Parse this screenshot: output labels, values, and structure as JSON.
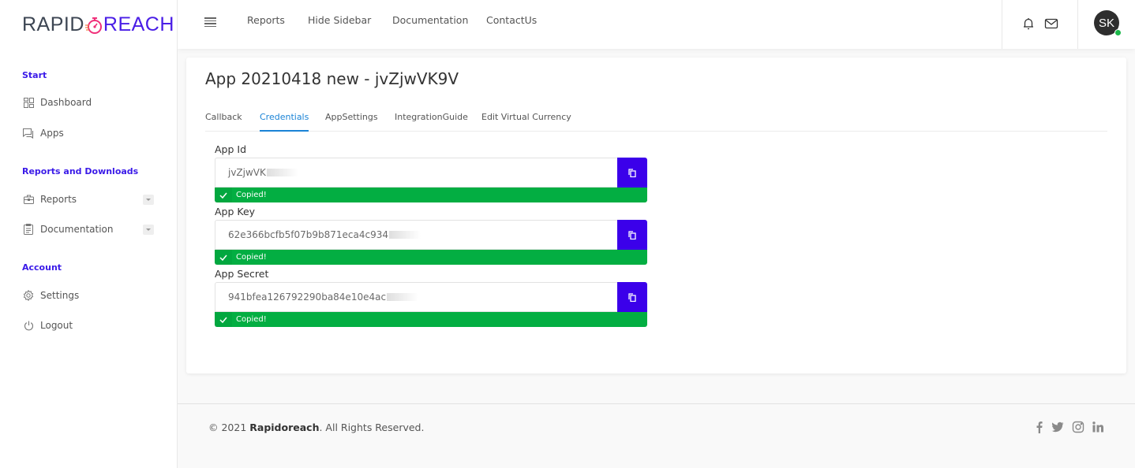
{
  "brand": {
    "part1": "RAPID",
    "part2": "REACH",
    "accent": "#4a1ee6",
    "timer_color": "#f0307a"
  },
  "topnav": {
    "links": [
      "Reports",
      "Hide Sidebar",
      "Documentation",
      "ContactUs"
    ],
    "avatar_initials": "SK",
    "status_color": "#1bb84a"
  },
  "sidebar": {
    "sections": [
      {
        "title": "Start",
        "items": [
          {
            "label": "Dashboard",
            "icon": "dashboard-icon"
          },
          {
            "label": "Apps",
            "icon": "apps-icon"
          }
        ]
      },
      {
        "title": "Reports and Downloads",
        "items": [
          {
            "label": "Reports",
            "icon": "briefcase-icon",
            "expandable": true
          },
          {
            "label": "Documentation",
            "icon": "clipboard-icon",
            "expandable": true
          }
        ]
      },
      {
        "title": "Account",
        "items": [
          {
            "label": "Settings",
            "icon": "gear-icon"
          },
          {
            "label": "Logout",
            "icon": "power-icon"
          }
        ]
      }
    ]
  },
  "page": {
    "title": "App 20210418 new - jvZjwVK9V",
    "tabs": [
      "Callback",
      "Credentials",
      "AppSettings",
      "IntegrationGuide",
      "Edit Virtual Currency"
    ],
    "active_tab": "Credentials",
    "fields": [
      {
        "label": "App Id",
        "value": "jvZjwVK",
        "status": "Copied!"
      },
      {
        "label": "App Key",
        "value": "62e366bcfb5f07b9b871eca4c934",
        "status": "Copied!"
      },
      {
        "label": "App Secret",
        "value": "941bfea126792290ba84e10e4ac",
        "status": "Copied!"
      }
    ],
    "copy_button_color": "#3b00ea",
    "copied_color": "#03ae42"
  },
  "footer": {
    "prefix": "© 2021 ",
    "brand": "Rapidoreach",
    "suffix": ". All Rights Reserved.",
    "social": [
      "facebook",
      "twitter",
      "instagram",
      "linkedin"
    ]
  }
}
